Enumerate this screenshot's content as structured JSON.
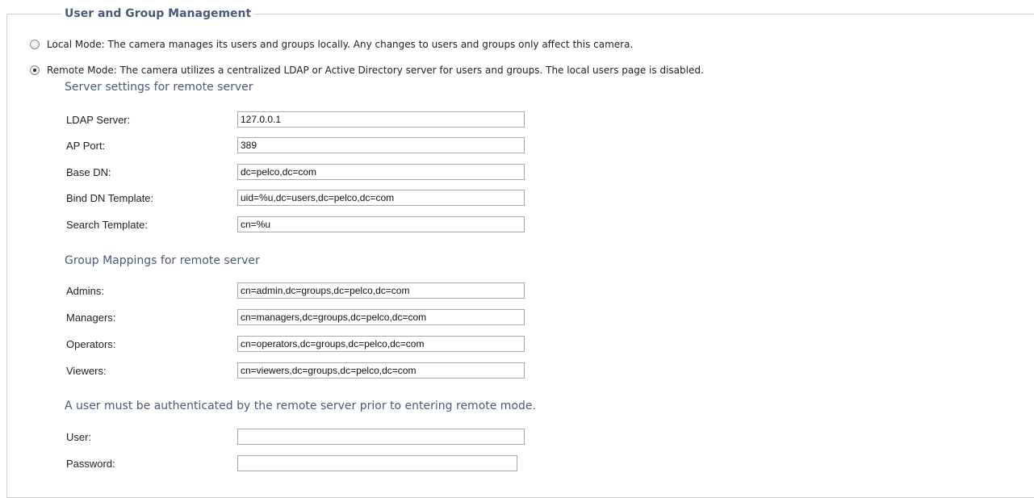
{
  "panel": {
    "title": "User and Group Management"
  },
  "modes": [
    {
      "label": "Local Mode: The camera manages its users and groups locally. Any changes to users and groups only affect this camera.",
      "selected": false
    },
    {
      "label": "Remote Mode: The camera utilizes a centralized LDAP or Active Directory server for users and groups. The local users page is disabled.",
      "selected": true
    }
  ],
  "server_settings": {
    "heading": "Server settings for remote server",
    "fields": [
      {
        "label": "LDAP Server:",
        "value": "127.0.0.1"
      },
      {
        "label": "AP Port:",
        "value": "389"
      },
      {
        "label": "Base DN:",
        "value": "dc=pelco,dc=com"
      },
      {
        "label": "Bind DN Template:",
        "value": "uid=%u,dc=users,dc=pelco,dc=com"
      },
      {
        "label": "Search Template:",
        "value": "cn=%u"
      }
    ]
  },
  "group_mappings": {
    "heading": "Group Mappings for remote server",
    "fields": [
      {
        "label": "Admins:",
        "value": "cn=admin,dc=groups,dc=pelco,dc=com"
      },
      {
        "label": "Managers:",
        "value": "cn=managers,dc=groups,dc=pelco,dc=com"
      },
      {
        "label": "Operators:",
        "value": "cn=operators,dc=groups,dc=pelco,dc=com"
      },
      {
        "label": "Viewers:",
        "value": "cn=viewers,dc=groups,dc=pelco,dc=com"
      }
    ]
  },
  "authentication": {
    "heading": "A user must be authenticated by the remote server prior to entering remote mode.",
    "fields": [
      {
        "label": "User:",
        "value": ""
      },
      {
        "label": "Password:",
        "value": ""
      }
    ]
  }
}
